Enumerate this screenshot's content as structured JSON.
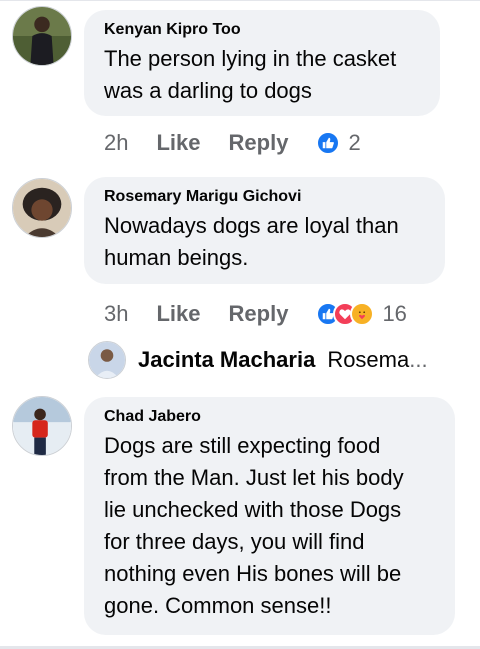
{
  "comments": [
    {
      "author": "Kenyan Kipro Too",
      "lines": [
        "The person lying in the casket",
        "was a darling to dogs"
      ],
      "time": "2h",
      "like_label": "Like",
      "reply_label": "Reply",
      "reaction_count": "2",
      "reactions": [
        "like"
      ]
    },
    {
      "author": "Rosemary Marigu Gichovi",
      "lines": [
        "Nowadays dogs are loyal than",
        "human beings."
      ],
      "time": "3h",
      "like_label": "Like",
      "reply_label": "Reply",
      "reaction_count": "16",
      "reactions": [
        "like",
        "love",
        "care"
      ]
    },
    {
      "author": "Chad Jabero",
      "lines": [
        "Dogs are still expecting food",
        "from the Man. Just let his body",
        "lie unchecked with those Dogs",
        "for three days, you will find",
        "nothing even His bones will be",
        "gone. Common sense!!"
      ]
    }
  ],
  "reply_preview": {
    "author": "Jacinta Macharia",
    "text": "Rosema",
    "ellipsis": "..."
  },
  "colors": {
    "bubble": "#f0f2f5",
    "meta_text": "#65676b",
    "like_blue": "#1877f2",
    "love_red": "#f33e58",
    "care_yellow": "#f7b125"
  }
}
